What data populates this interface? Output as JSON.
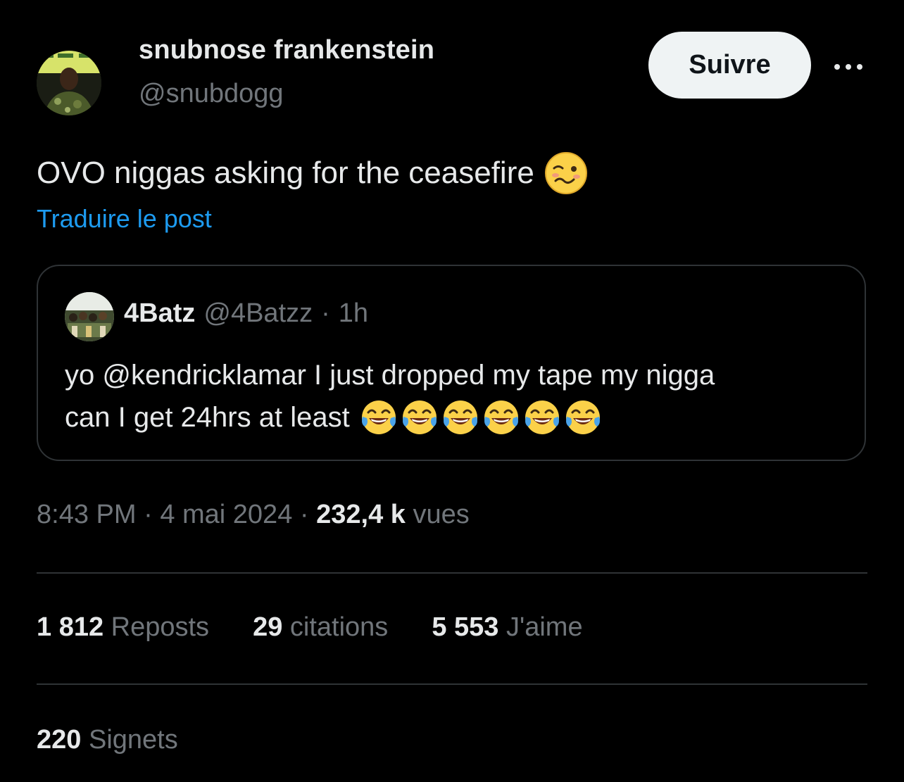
{
  "author": {
    "display_name": "snubnose frankenstein",
    "handle": "@snubdogg",
    "follow_label": "Suivre",
    "more_label": "•••"
  },
  "tweet": {
    "text": "OVO niggas asking for the ceasefire",
    "emoji": "woozy-face-emoji",
    "translate_label": "Traduire le post"
  },
  "quoted": {
    "name": "4Batz",
    "handle": "@4Batzz",
    "separator": "·",
    "time": "1h",
    "line1": "yo @kendricklamar I just dropped my tape my nigga",
    "line2": "can I get 24hrs at least",
    "emoji": "tears-of-joy-emoji",
    "emoji_count": 6
  },
  "meta": {
    "time": "8:43 PM",
    "sep1": "·",
    "date": "4 mai 2024",
    "sep2": "·",
    "views_count": "232,4 k",
    "views_label": "vues"
  },
  "stats": {
    "reposts_count": "1 812",
    "reposts_label": "Reposts",
    "quotes_count": "29",
    "quotes_label": "citations",
    "likes_count": "5 553",
    "likes_label": "J'aime"
  },
  "bookmarks": {
    "count": "220",
    "label": "Signets"
  },
  "colors": {
    "background": "#000000",
    "primary_text": "#e7e9ea",
    "secondary_text": "#71767b",
    "link": "#1d9bf0",
    "border": "#2f3336",
    "follow_button_bg": "#eff3f4",
    "emoji_yellow": "#fbd149"
  }
}
